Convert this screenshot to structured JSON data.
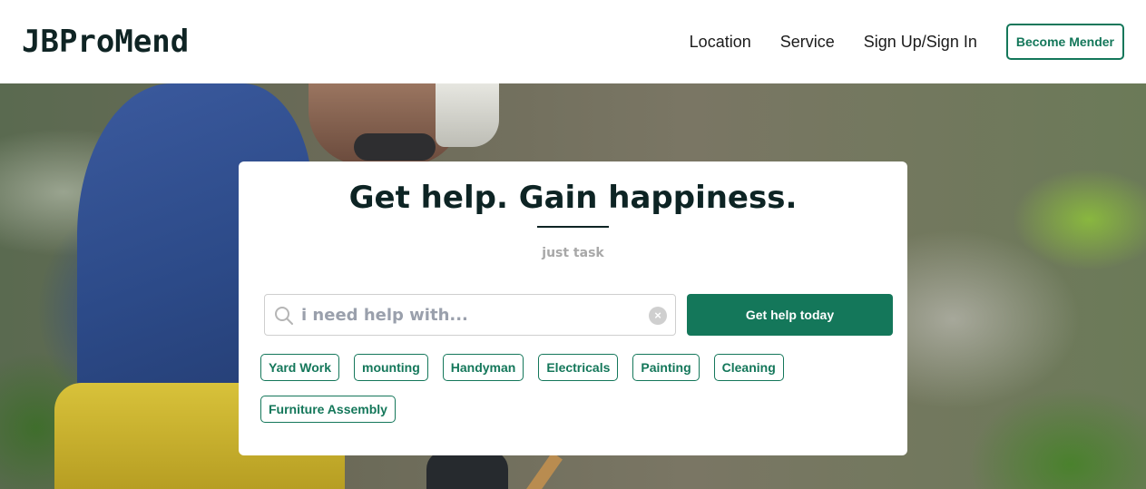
{
  "header": {
    "logo": "JBProMend",
    "nav": [
      "Location",
      "Service",
      "Sign Up/Sign In"
    ],
    "cta": "Become Mender"
  },
  "hero": {
    "title": "Get help. Gain happiness.",
    "subtitle": "just task",
    "search": {
      "placeholder": "i need help with...",
      "value": ""
    },
    "button": "Get help today",
    "tags": [
      "Yard Work",
      "mounting",
      "Handyman",
      "Electricals",
      "Painting",
      "Cleaning",
      "Furniture Assembly"
    ]
  },
  "colors": {
    "brand": "#14775a",
    "heading": "#0d2424",
    "muted": "#a8a8a8"
  }
}
